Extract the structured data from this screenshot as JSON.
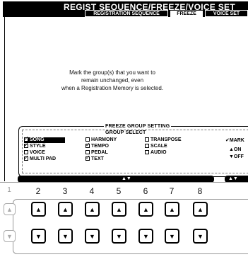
{
  "lcd": {
    "title": "REGIST SEQUENCE/FREEZE/VOICE SET",
    "tabs": [
      {
        "label": "REGISTRATION SEQUENCE",
        "active": false
      },
      {
        "label": "FREEZE",
        "active": true
      },
      {
        "label": "VOICE SET",
        "active": false
      }
    ],
    "message_lines": [
      "Mark the group(s) that you want to",
      "remain unchanged, even",
      "when a Registration Memory is selected."
    ]
  },
  "freeze_panel": {
    "title": "FREEZE GROUP SETTING",
    "subtitle": "GROUP SELECT",
    "groups": [
      {
        "label": "SONG",
        "checked": true,
        "selected": true
      },
      {
        "label": "STYLE",
        "checked": true
      },
      {
        "label": "VOICE",
        "checked": false
      },
      {
        "label": "MULTI PAD",
        "checked": true
      },
      {
        "label": "HARMONY",
        "checked": false
      },
      {
        "label": "TEMPO",
        "checked": true
      },
      {
        "label": "PEDAL",
        "checked": false
      },
      {
        "label": "TEXT",
        "checked": true
      },
      {
        "label": "TRANSPOSE",
        "checked": false
      },
      {
        "label": "SCALE",
        "checked": false
      },
      {
        "label": "AUDIO",
        "checked": false
      }
    ],
    "side_labels": {
      "mark": "✔MARK",
      "on": "▲ON",
      "off": "▼OFF"
    },
    "control_arrows": "▲▼",
    "control_arrows_right": "▲▼"
  },
  "hardware": {
    "numbers": [
      "1",
      "2",
      "3",
      "4",
      "5",
      "6",
      "7",
      "8"
    ]
  }
}
